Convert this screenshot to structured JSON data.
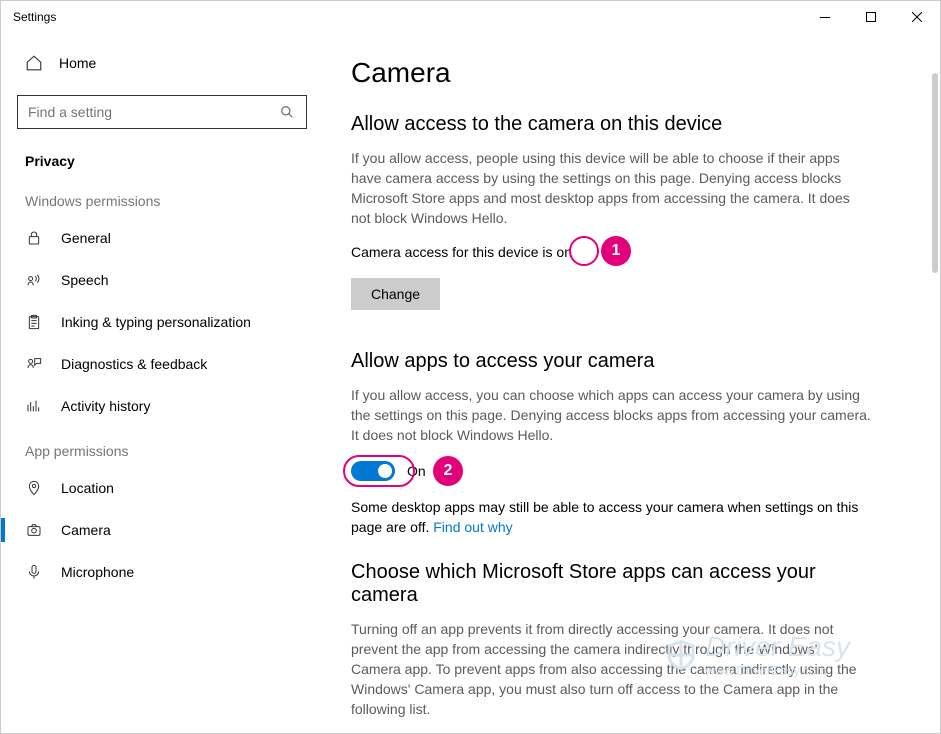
{
  "window": {
    "title": "Settings"
  },
  "sidebar": {
    "home": "Home",
    "search_placeholder": "Find a setting",
    "current_section": "Privacy",
    "group1_label": "Windows permissions",
    "group1": [
      {
        "label": "General"
      },
      {
        "label": "Speech"
      },
      {
        "label": "Inking & typing personalization"
      },
      {
        "label": "Diagnostics & feedback"
      },
      {
        "label": "Activity history"
      }
    ],
    "group2_label": "App permissions",
    "group2": [
      {
        "label": "Location"
      },
      {
        "label": "Camera"
      },
      {
        "label": "Microphone"
      }
    ]
  },
  "main": {
    "title": "Camera",
    "section1": {
      "heading": "Allow access to the camera on this device",
      "body": "If you allow access, people using this device will be able to choose if their apps have camera access by using the settings on this page. Denying access blocks Microsoft Store apps and most desktop apps from accessing the camera. It does not block Windows Hello.",
      "status_prefix": "Camera access for this device is ",
      "status_value": "on",
      "change_btn": "Change"
    },
    "section2": {
      "heading": "Allow apps to access your camera",
      "body": "If you allow access, you can choose which apps can access your camera by using the settings on this page. Denying access blocks apps from accessing your camera. It does not block Windows Hello.",
      "toggle_state": "On",
      "footnote_a": "Some desktop apps may still be able to access your camera when settings on this page are off. ",
      "footnote_link": "Find out why"
    },
    "section3": {
      "heading": "Choose which Microsoft Store apps can access your camera",
      "body": "Turning off an app prevents it from directly accessing your camera. It does not prevent the app from accessing the camera indirectly through the Windows' Camera app. To prevent apps from also accessing the camera indirectly using the Windows' Camera app, you must also turn off access to the Camera app in the following list."
    }
  },
  "annotations": {
    "badge1": "1",
    "badge2": "2"
  },
  "watermark": {
    "brand": "Driver Easy",
    "url": "www.DriverEasy.com"
  }
}
